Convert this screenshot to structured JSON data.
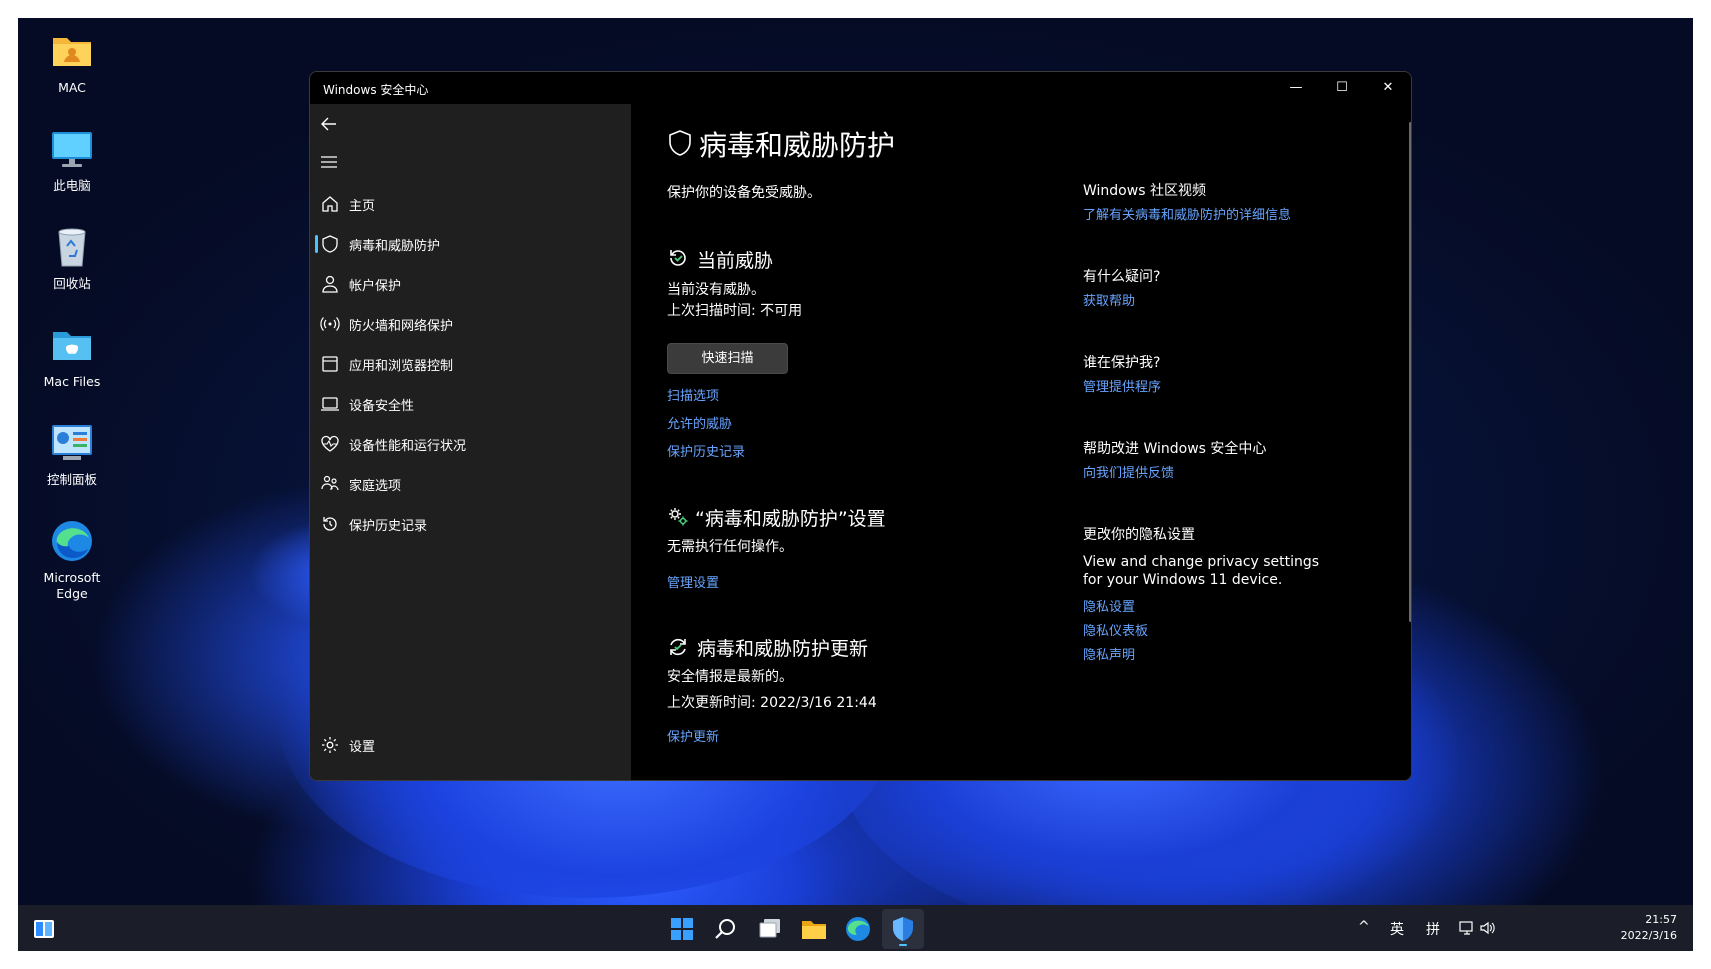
{
  "desktop": {
    "icons": [
      {
        "label": "MAC",
        "icon": "user-folder-icon"
      },
      {
        "label": "此电脑",
        "icon": "monitor-icon"
      },
      {
        "label": "回收站",
        "icon": "recycle-bin-icon"
      },
      {
        "label": "Mac Files",
        "icon": "folder-icon"
      },
      {
        "label": "控制面板",
        "icon": "control-panel-icon"
      },
      {
        "label": "Microsoft Edge",
        "icon": "edge-icon"
      }
    ]
  },
  "window": {
    "title": "Windows 安全中心",
    "buttons": {
      "minimize": "—",
      "maximize": "☐",
      "close": "✕"
    }
  },
  "sidebar": {
    "back_icon": "back-arrow-icon",
    "menu_icon": "hamburger-icon",
    "items": [
      {
        "label": "主页",
        "icon": "home-icon"
      },
      {
        "label": "病毒和威胁防护",
        "icon": "shield-icon",
        "active": true
      },
      {
        "label": "帐户保护",
        "icon": "person-icon"
      },
      {
        "label": "防火墙和网络保护",
        "icon": "wifi-signal-icon"
      },
      {
        "label": "应用和浏览器控制",
        "icon": "app-window-icon"
      },
      {
        "label": "设备安全性",
        "icon": "laptop-icon"
      },
      {
        "label": "设备性能和运行状况",
        "icon": "heart-icon"
      },
      {
        "label": "家庭选项",
        "icon": "family-icon"
      },
      {
        "label": "保护历史记录",
        "icon": "history-icon"
      }
    ],
    "settings": {
      "label": "设置",
      "icon": "gear-icon"
    }
  },
  "main": {
    "title": "病毒和威胁防护",
    "subtitle": "保护你的设备免受威胁。",
    "current_threats": {
      "heading": "当前威胁",
      "line1": "当前没有威胁。",
      "line2": "上次扫描时间: 不可用",
      "quick_scan": "快速扫描",
      "links": [
        "扫描选项",
        "允许的威胁",
        "保护历史记录"
      ]
    },
    "settings_section": {
      "heading": "“病毒和威胁防护”设置",
      "text": "无需执行任何操作。",
      "link": "管理设置"
    },
    "updates_section": {
      "heading": "病毒和威胁防护更新",
      "line1": "安全情报是最新的。",
      "line2": "上次更新时间: 2022/3/16 21:44",
      "link": "保护更新"
    }
  },
  "side_panel": {
    "community": {
      "heading": "Windows 社区视频",
      "link": "了解有关病毒和威胁防护的详细信息"
    },
    "question": {
      "heading": "有什么疑问?",
      "link": "获取帮助"
    },
    "who": {
      "heading": "谁在保护我?",
      "link": "管理提供程序"
    },
    "improve": {
      "heading": "帮助改进 Windows 安全中心",
      "link": "向我们提供反馈"
    },
    "privacy": {
      "heading": "更改你的隐私设置",
      "text1": "View and change privacy settings",
      "text2": "for your Windows 11 device.",
      "links": [
        "隐私设置",
        "隐私仪表板",
        "隐私声明"
      ]
    }
  },
  "taskbar": {
    "tray": {
      "chevron": "^",
      "lang": "英",
      "ime": "拼"
    },
    "time": "21:57",
    "date": "2022/3/16"
  },
  "colors": {
    "accent": "#4cc2ff",
    "link": "#67a4ff"
  }
}
